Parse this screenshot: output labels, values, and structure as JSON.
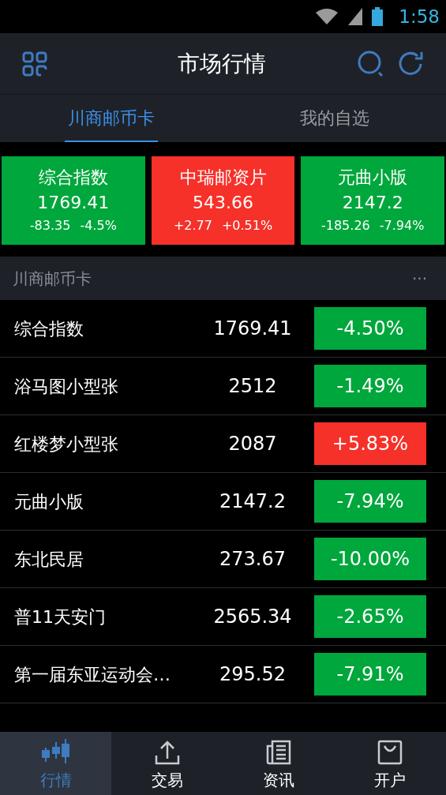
{
  "status_bar": {
    "time": "1:58"
  },
  "header": {
    "title": "市场行情"
  },
  "tabs": [
    {
      "label": "川商邮币卡",
      "selected": true
    },
    {
      "label": "我的自选",
      "selected": false
    }
  ],
  "index_cards": [
    {
      "name": "综合指数",
      "value": "1769.41",
      "change": "-83.35",
      "percent": "-4.5%",
      "color": "#00a73c"
    },
    {
      "name": "中瑞邮资片",
      "value": "543.66",
      "change": "+2.77",
      "percent": "+0.51%",
      "color": "#f5312a"
    },
    {
      "name": "元曲小版",
      "value": "2147.2",
      "change": "-185.26",
      "percent": "-7.94%",
      "color": "#00a73c"
    }
  ],
  "section": {
    "title": "川商邮币卡",
    "more": "···"
  },
  "rows": [
    {
      "name": "综合指数",
      "price": "1769.41",
      "change": "-4.50%",
      "color": "#00a73c"
    },
    {
      "name": "浴马图小型张",
      "price": "2512",
      "change": "-1.49%",
      "color": "#00a73c"
    },
    {
      "name": "红楼梦小型张",
      "price": "2087",
      "change": "+5.83%",
      "color": "#f5312a"
    },
    {
      "name": "元曲小版",
      "price": "2147.2",
      "change": "-7.94%",
      "color": "#00a73c"
    },
    {
      "name": "东北民居",
      "price": "273.67",
      "change": "-10.00%",
      "color": "#00a73c"
    },
    {
      "name": "普11天安门",
      "price": "2565.34",
      "change": "-2.65%",
      "color": "#00a73c"
    },
    {
      "name": "第一届东亚运动会…",
      "price": "295.52",
      "change": "-7.91%",
      "color": "#00a73c"
    }
  ],
  "bottom_nav": [
    {
      "label": "行情",
      "selected": true
    },
    {
      "label": "交易",
      "selected": false
    },
    {
      "label": "资讯",
      "selected": false
    },
    {
      "label": "开户",
      "selected": false
    }
  ]
}
